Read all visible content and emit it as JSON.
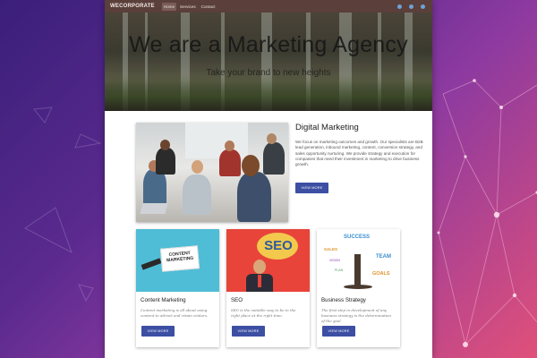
{
  "nav": {
    "brand": "WECORPORATE",
    "links": [
      "Home",
      "Services",
      "Contact"
    ],
    "social": [
      "twitter-icon",
      "facebook-icon",
      "linkedin-icon"
    ]
  },
  "hero": {
    "title": "We are a Marketing Agency",
    "subtitle": "Take your brand to new heights"
  },
  "feature": {
    "title": "Digital Marketing",
    "body": "We focus on marketing outcomes and growth. Our specialists are B2B lead generation, inbound marketing, content, conversion strategy, and sales opportunity nurturing. We provide strategy and execution for companies that need their investment in marketing to drive business growth.",
    "button": "VIEW MORE"
  },
  "cards": [
    {
      "title": "Content Marketing",
      "image_label": "CONTENT MARKETING",
      "body": "Content marketing is all about using content to attract and retain visitors.",
      "button": "VIEW MORE"
    },
    {
      "title": "SEO",
      "image_label": "SEO",
      "body": "SEO is the suitable way to be in the right place at the right time.",
      "button": "VIEW MORE"
    },
    {
      "title": "Business Strategy",
      "image_words": [
        "SUCCESS",
        "SALES",
        "TEAM",
        "GOALS",
        "VISION",
        "PLAN"
      ],
      "body": "The first step in development of any business strategy is the determination of the goal.",
      "button": "VIEW MORE"
    }
  ],
  "colors": {
    "nav_bg": "#5a3f3a",
    "button": "#3c4fa3",
    "background_start": "#3a1f7a",
    "background_end": "#e0507a"
  }
}
